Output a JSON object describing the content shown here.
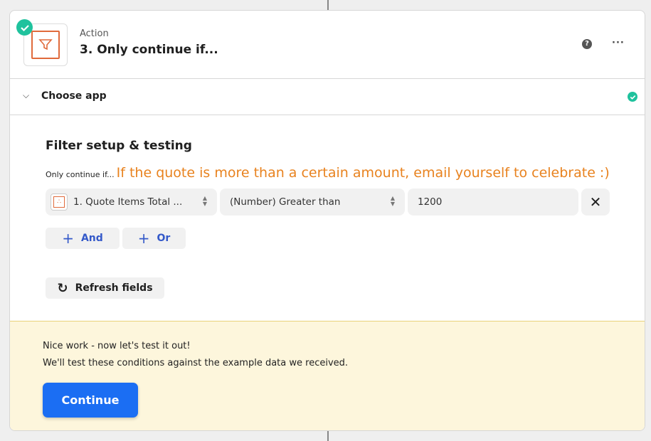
{
  "step": {
    "kicker": "Action",
    "title": "3. Only continue if..."
  },
  "section": {
    "label": "Choose app"
  },
  "filter": {
    "heading": "Filter setup & testing",
    "prefix": "Only continue if...",
    "note": "If the quote is more than a certain amount, email yourself to celebrate :)",
    "field": "1. Quote Items Total ...",
    "condition": "(Number) Greater than",
    "value": "1200"
  },
  "buttons": {
    "and": "And",
    "or": "Or",
    "refresh": "Refresh fields",
    "continue": "Continue"
  },
  "test": {
    "line1": "Nice work - now let's test it out!",
    "line2": "We'll test these conditions against the example data we received."
  },
  "colors": {
    "accent": "#1b6ef3",
    "success": "#1fc29d",
    "brand": "#e06a3b",
    "note": "#e8821e"
  }
}
